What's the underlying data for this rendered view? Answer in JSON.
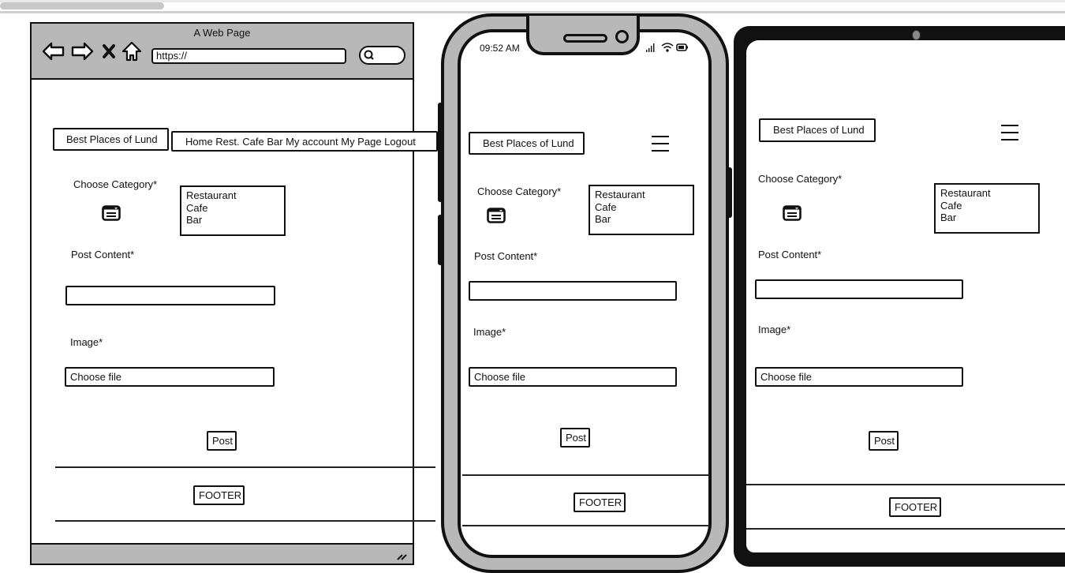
{
  "desktop": {
    "window_title": "A Web Page",
    "url": "https://",
    "brand": "Best Places of Lund",
    "nav": "Home Rest. Cafe Bar My account My Page Logout",
    "category_label": "Choose Category*",
    "category_options": [
      "Restaurant",
      "Cafe",
      "Bar"
    ],
    "content_label": "Post Content*",
    "content_value": "",
    "image_label": "Image*",
    "file_input": "Choose file",
    "post_button": "Post",
    "footer": "FOOTER"
  },
  "phone": {
    "time": "09:52 AM",
    "brand": "Best Places of Lund",
    "category_label": "Choose Category*",
    "category_options": [
      "Restaurant",
      "Cafe",
      "Bar"
    ],
    "content_label": "Post Content*",
    "content_value": "",
    "image_label": "Image*",
    "file_input": "Choose file",
    "post_button": "Post",
    "footer": "FOOTER"
  },
  "tablet": {
    "brand": "Best Places of Lund",
    "category_label": "Choose Category*",
    "category_options": [
      "Restaurant",
      "Cafe",
      "Bar"
    ],
    "content_label": "Post Content*",
    "content_value": "",
    "image_label": "Image*",
    "file_input": "Choose file",
    "post_button": "Post",
    "footer": "FOOTER"
  }
}
